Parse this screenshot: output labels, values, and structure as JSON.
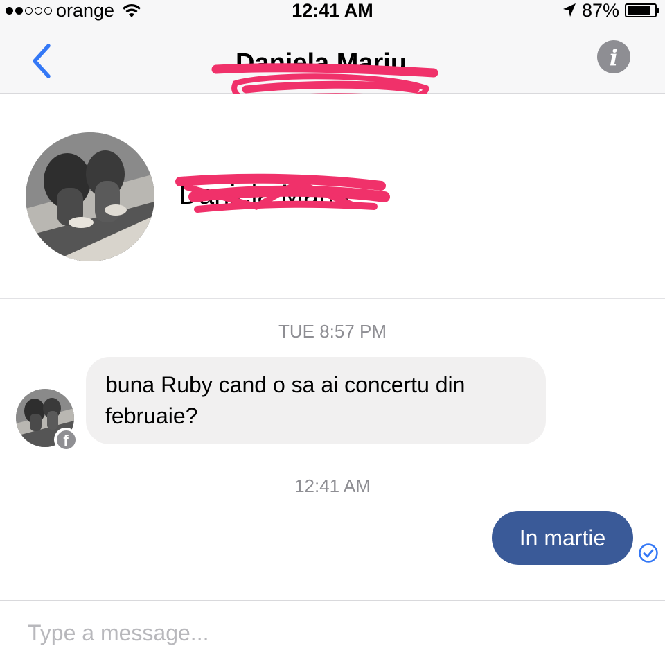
{
  "status_bar": {
    "carrier": "orange",
    "time": "12:41 AM",
    "battery_percent": "87%",
    "battery_level": 0.87,
    "signal_bars_filled": 2,
    "signal_bars_total": 5
  },
  "nav": {
    "back_icon": "chevron-left-icon",
    "title": "Daniela Mariu",
    "info_icon": "info-icon",
    "info_glyph": "i"
  },
  "profile": {
    "name": "Daniela Mariu"
  },
  "messages": {
    "timestamp_1": "TUE 8:57 PM",
    "incoming_text": "buna Ruby cand o sa ai concertu din februaie?",
    "timestamp_2": "12:41 AM",
    "outgoing_text": "In martie",
    "badge_glyph": "f"
  },
  "composer": {
    "placeholder": "Type a message..."
  },
  "colors": {
    "accent_blue": "#3478f6",
    "outgoing_bubble": "#3a5a98",
    "incoming_bubble": "#f1f0f0",
    "redaction_pink": "#f0316a",
    "muted_gray": "#8e8e93"
  }
}
